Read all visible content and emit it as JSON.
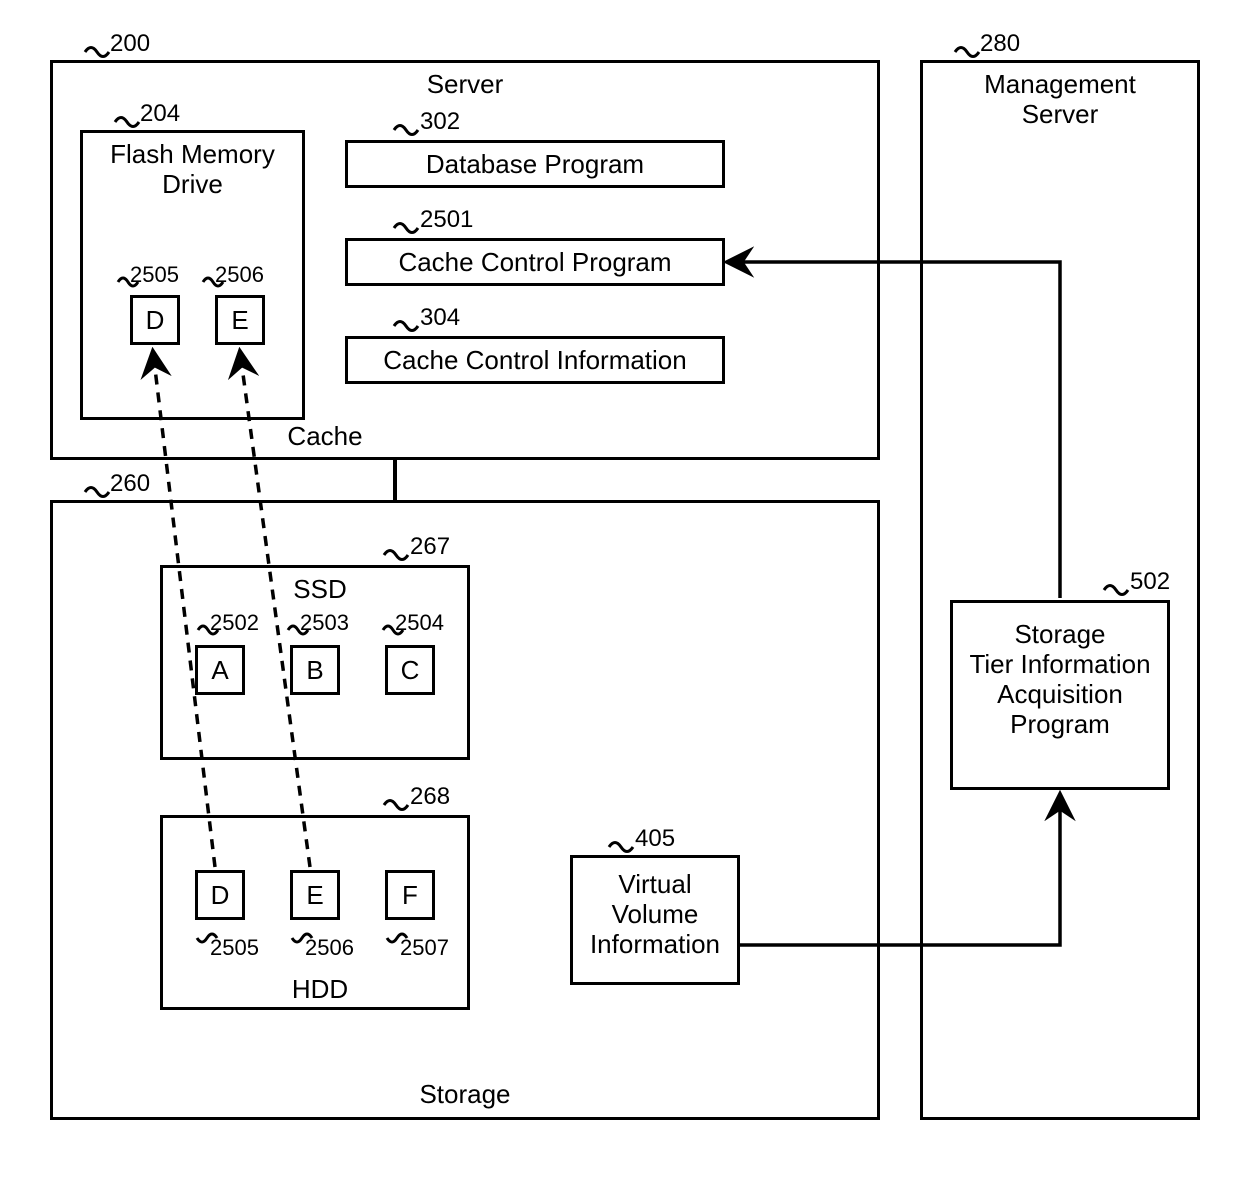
{
  "server": {
    "ref": "200",
    "title": "Server",
    "flash": {
      "ref": "204",
      "title": "Flash Memory\nDrive",
      "cacheLabel": "Cache",
      "d": {
        "ref": "2505",
        "letter": "D"
      },
      "e": {
        "ref": "2506",
        "letter": "E"
      }
    },
    "db": {
      "ref": "302",
      "title": "Database Program"
    },
    "ccp": {
      "ref": "2501",
      "title": "Cache Control Program"
    },
    "cci": {
      "ref": "304",
      "title": "Cache Control Information"
    }
  },
  "storage": {
    "ref": "260",
    "title": "Storage",
    "ssd": {
      "ref": "267",
      "title": "SSD",
      "a": {
        "ref": "2502",
        "letter": "A"
      },
      "b": {
        "ref": "2503",
        "letter": "B"
      },
      "c": {
        "ref": "2504",
        "letter": "C"
      }
    },
    "hdd": {
      "ref": "268",
      "title": "HDD",
      "d": {
        "ref": "2505",
        "letter": "D"
      },
      "e": {
        "ref": "2506",
        "letter": "E"
      },
      "f": {
        "ref": "2507",
        "letter": "F"
      }
    },
    "vvi": {
      "ref": "405",
      "title": "Virtual\nVolume\nInformation"
    }
  },
  "mgmt": {
    "ref": "280",
    "title": "Management\nServer",
    "prog": {
      "ref": "502",
      "title": "Storage\nTier Information\nAcquisition\nProgram"
    }
  }
}
